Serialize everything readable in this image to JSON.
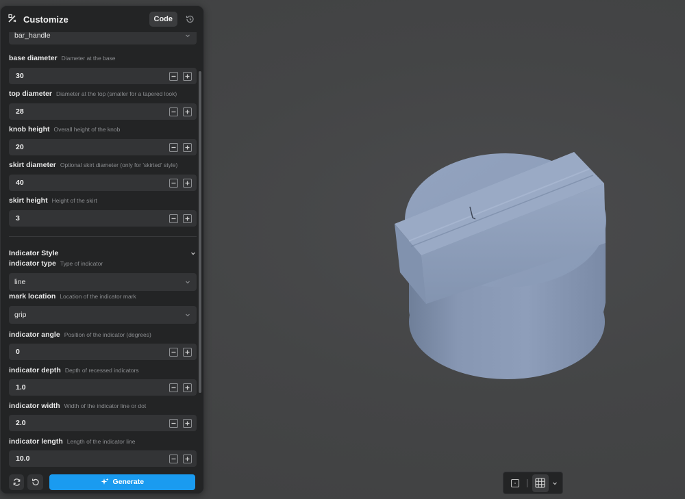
{
  "panel": {
    "title": "Customize",
    "code_label": "Code",
    "top_select_value": "bar_handle",
    "parameters_top": [
      {
        "label": "base diameter",
        "desc": "Diameter at the base",
        "value": "30"
      },
      {
        "label": "top diameter",
        "desc": "Diameter at the top (smaller for a tapered look)",
        "value": "28"
      },
      {
        "label": "knob height",
        "desc": "Overall height of the knob",
        "value": "20"
      },
      {
        "label": "skirt diameter",
        "desc": "Optional skirt diameter (only for 'skirted' style)",
        "value": "40"
      },
      {
        "label": "skirt height",
        "desc": "Height of the skirt",
        "value": "3"
      }
    ],
    "section": {
      "title": "Indicator Style"
    },
    "indicator_type": {
      "label": "indicator type",
      "desc": "Type of indicator",
      "value": "line"
    },
    "mark_location": {
      "label": "mark location",
      "desc": "Location of the indicator mark",
      "value": "grip"
    },
    "parameters_bottom": [
      {
        "label": "indicator angle",
        "desc": "Position of the indicator (degrees)",
        "value": "0"
      },
      {
        "label": "indicator depth",
        "desc": "Depth of recessed indicators",
        "value": "1.0"
      },
      {
        "label": "indicator width",
        "desc": "Width of the indicator line or dot",
        "value": "2.0"
      },
      {
        "label": "indicator length",
        "desc": "Length of the indicator line",
        "value": "10.0"
      }
    ],
    "generate_label": "Generate"
  },
  "icons": {
    "title": "wand-icon",
    "history": "history-icon",
    "refresh": "refresh-icon",
    "reset": "undo-icon",
    "generate": "sparkle-icon",
    "increment": "plus-icon",
    "decrement": "minus-icon",
    "view_single": "single-view-icon",
    "view_grid": "grid-icon"
  },
  "colors": {
    "accent": "#1a9bf0",
    "model": "#8a9bb7",
    "background": "#444546",
    "panel": "#232425"
  }
}
